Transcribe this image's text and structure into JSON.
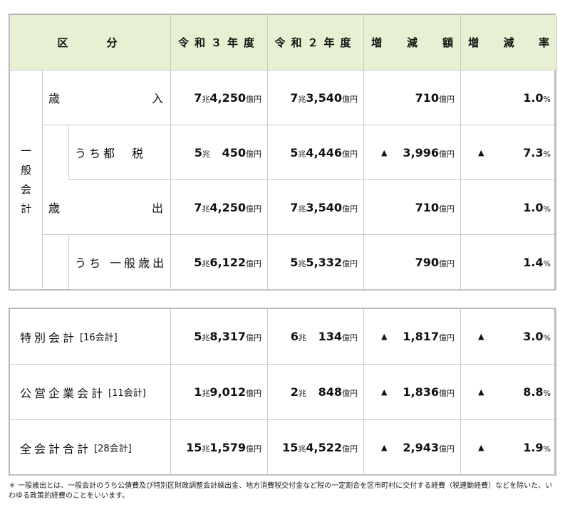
{
  "header": {
    "kubun": "区　　分",
    "r3": "令和３年度",
    "r2": "令和２年度",
    "diff": [
      "増",
      "減",
      "額"
    ],
    "rate": [
      "増",
      "減",
      "率"
    ]
  },
  "general": {
    "label": [
      "一",
      "般",
      "会",
      "計"
    ],
    "rows": [
      {
        "name_a": "歳",
        "name_b": "入",
        "r3": [
          "7",
          "兆",
          "4,250",
          "億円"
        ],
        "r2": [
          "7",
          "兆",
          "3,540",
          "億円"
        ],
        "diff_mark": "",
        "diff": "710",
        "diff_unit": "億円",
        "rate_mark": "",
        "rate": "1.0",
        "rate_unit": "%"
      },
      {
        "name": "うち都　税",
        "r3": [
          "5",
          "兆",
          "450",
          "億円"
        ],
        "r2": [
          "5",
          "兆",
          "4,446",
          "億円"
        ],
        "diff_mark": "▲",
        "diff": "3,996",
        "diff_unit": "億円",
        "rate_mark": "▲",
        "rate": "7.3",
        "rate_unit": "%"
      },
      {
        "name_a": "歳",
        "name_b": "出",
        "r3": [
          "7",
          "兆",
          "4,250",
          "億円"
        ],
        "r2": [
          "7",
          "兆",
          "3,540",
          "億円"
        ],
        "diff_mark": "",
        "diff": "710",
        "diff_unit": "億円",
        "rate_mark": "",
        "rate": "1.0",
        "rate_unit": "%"
      },
      {
        "name": "うち 一般歳出",
        "r3": [
          "5",
          "兆",
          "6,122",
          "億円"
        ],
        "r2": [
          "5",
          "兆",
          "5,332",
          "億円"
        ],
        "diff_mark": "",
        "diff": "790",
        "diff_unit": "億円",
        "rate_mark": "",
        "rate": "1.4",
        "rate_unit": "%"
      }
    ]
  },
  "other": [
    {
      "name": "特別会計",
      "sub": "[16会計]",
      "r3": [
        "5",
        "兆",
        "8,317",
        "億円"
      ],
      "r2": [
        "6",
        "兆",
        "134",
        "億円"
      ],
      "diff_mark": "▲",
      "diff": "1,817",
      "diff_unit": "億円",
      "rate_mark": "▲",
      "rate": "3.0",
      "rate_unit": "%"
    },
    {
      "name": "公営企業会計",
      "sub": "[11会計]",
      "r3": [
        "1",
        "兆",
        "9,012",
        "億円"
      ],
      "r2": [
        "2",
        "兆",
        "848",
        "億円"
      ],
      "diff_mark": "▲",
      "diff": "1,836",
      "diff_unit": "億円",
      "rate_mark": "▲",
      "rate": "8.8",
      "rate_unit": "%"
    },
    {
      "name": "全会計合計",
      "sub": "[28会計]",
      "r3": [
        "15",
        "兆",
        "1,579",
        "億円"
      ],
      "r2": [
        "15",
        "兆",
        "4,522",
        "億円"
      ],
      "diff_mark": "▲",
      "diff": "2,943",
      "diff_unit": "億円",
      "rate_mark": "",
      "rate": "1.9",
      "rate_unit": "%"
    }
  ],
  "other_rate_mark_row3": "▲",
  "note": "＊ 一般歳出とは、一般会計のうち公債費及び特別区財政調整会計繰出金、地方消費税交付金など税の一定割合を区市町村に交付する経費（税連動経費）などを除いた、いわゆる政策的経費のことをいいます。"
}
